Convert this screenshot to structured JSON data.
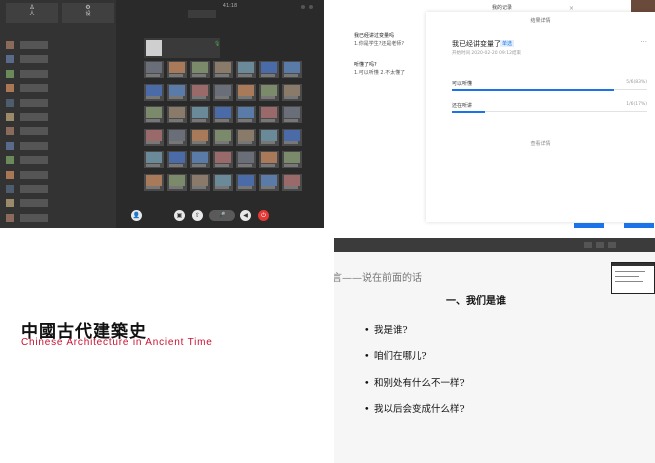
{
  "meeting": {
    "side_tabs": [
      {
        "icon": "person-icon",
        "glyph": "♙",
        "label": "人"
      },
      {
        "icon": "gear-icon",
        "glyph": "⚙",
        "label": "设"
      }
    ],
    "side_header": "",
    "title": "41:18",
    "controls": [
      {
        "icon": "participants-icon",
        "glyph": "👤"
      },
      {
        "icon": "camera-icon",
        "glyph": "▣"
      },
      {
        "icon": "share-icon",
        "glyph": "⇧"
      },
      {
        "icon": "mic-icon",
        "glyph": "🎤"
      },
      {
        "icon": "speaker-icon",
        "glyph": "◀"
      },
      {
        "icon": "hangup-icon",
        "glyph": "⏻"
      }
    ],
    "host_mic": "🎙"
  },
  "quiz": {
    "top_tab": "我的记录",
    "left_q1_title": "我已经讲过变量吗",
    "left_q1_sub": "1.你是学生?还是老师?",
    "left_q2_title": "听懂了吗?",
    "left_q2_sub": "1.可以听懂  2.不太懂了",
    "dialog_header": "结果详情",
    "close_glyph": "×",
    "question_title": "我已经讲变量了",
    "question_badge": "单选",
    "question_meta": "开始时间 2020-02-20 09:12结束",
    "more_glyph": "···",
    "options": [
      {
        "label": "可以听懂",
        "count": "5/6(83%)",
        "fraction": 0.83
      },
      {
        "label": "还在听讲",
        "count": "1/6(17%)",
        "fraction": 0.17
      }
    ],
    "detail_link": "查看详情"
  },
  "title_slide": {
    "chinese_title": "中國古代建築史",
    "english_title": "Chinese Architecture in Ancient Time"
  },
  "lecture_slide": {
    "header": "言——说在前面的话",
    "subheading": "一、我们是谁",
    "bullets": [
      "我是谁?",
      "咱们在哪儿?",
      "和别处有什么不一样?",
      "我以后会变成什么样?"
    ]
  }
}
